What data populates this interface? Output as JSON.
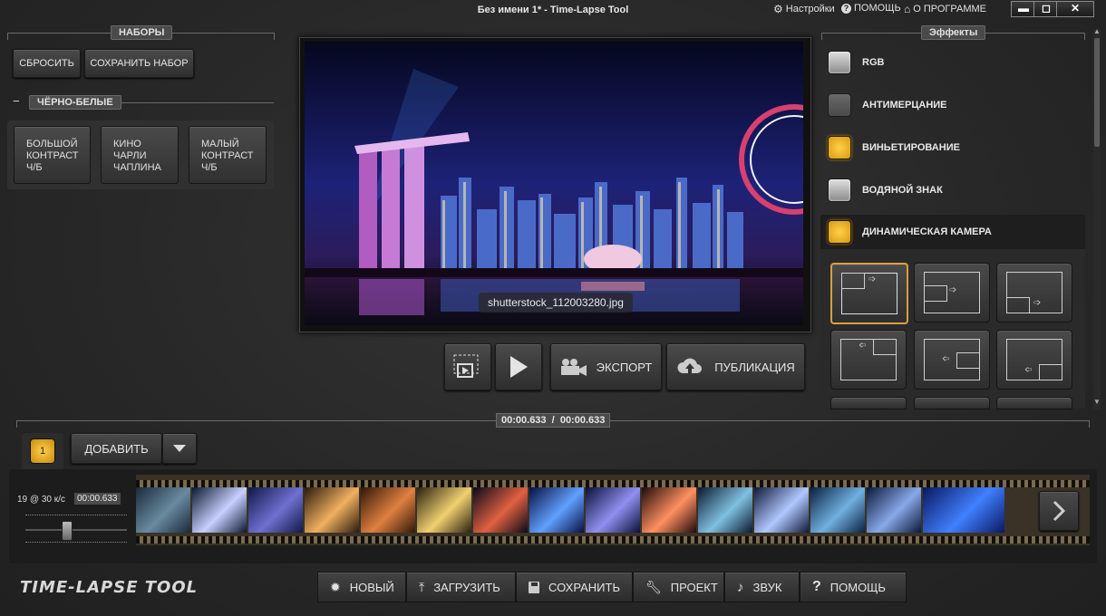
{
  "window": {
    "title": "Без имени 1* - Time-Lapse Tool",
    "links": {
      "settings": "Настройки",
      "help": "ПОМОЩЬ",
      "about": "О ПРОГРАММЕ"
    },
    "controls": {
      "minimize": "▬",
      "maximize": "◻",
      "close": "✕"
    }
  },
  "presets": {
    "section_title": "НАБОРЫ",
    "reset_label": "СБРОСИТЬ",
    "save_label": "СОХРАНИТЬ НАБОР",
    "group_title": "ЧЁРНО-БЕЛЫЕ",
    "group_collapse": "−",
    "items": [
      {
        "label": "БОЛЬШОЙ\nКОНТРАСТ\nЧ/Б"
      },
      {
        "label": "КИНО\nЧАРЛИ\nЧАПЛИНА"
      },
      {
        "label": "МАЛЫЙ\nКОНТРАСТ\nЧ/Б"
      }
    ]
  },
  "preview": {
    "filename": "shutterstock_112003280.jpg"
  },
  "controls": {
    "export_label": "ЭКСПОРТ",
    "publish_label": "ПУБЛИКАЦИЯ"
  },
  "effects": {
    "section_title": "Эффекты",
    "items": [
      {
        "label": "RGB",
        "state": "off"
      },
      {
        "label": "АНТИМЕРЦАНИЕ",
        "state": "dim"
      },
      {
        "label": "ВИНЬЕТИРОВАНИЕ",
        "state": "on"
      },
      {
        "label": "ВОДЯНОЙ ЗНАК",
        "state": "off"
      },
      {
        "label": "ДИНАМИЧЕСКАЯ КАМЕРА",
        "state": "on"
      }
    ]
  },
  "timeline": {
    "time_display": "00:00.633  /  00:00.633",
    "frame_badge": "1",
    "add_label": "ДОБАВИТЬ",
    "fps_label": "19 @ 30 к/с",
    "clip_time": "00:00.633",
    "fps_slider_value": 0.4
  },
  "bottom": {
    "logo": "TIME-LAPSE TOOL",
    "buttons": [
      {
        "label": "НОВЫЙ",
        "icon": "star-icon"
      },
      {
        "label": "ЗАГРУЗИТЬ",
        "icon": "upload-icon"
      },
      {
        "label": "СОХРАНИТЬ",
        "icon": "save-icon"
      },
      {
        "label": "ПРОЕКТ",
        "icon": "wrench-icon"
      },
      {
        "label": "ЗВУК",
        "icon": "music-icon"
      },
      {
        "label": "ПОМОЩЬ",
        "icon": "question-icon"
      }
    ]
  },
  "colors": {
    "accent": "#d8a040",
    "active_check": "#f0b830"
  }
}
